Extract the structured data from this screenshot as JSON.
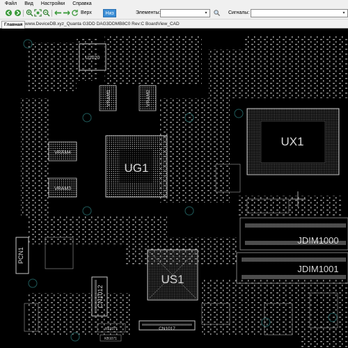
{
  "menu": {
    "file": "Файл",
    "view": "Вид",
    "settings": "Настройки",
    "help": "Справка"
  },
  "toolbar": {
    "side_top_label": "Верх",
    "side_bottom_label": "Низ",
    "elements_label": "Элементы:",
    "elements_value": "",
    "signals_label": "Сигналы:",
    "signals_value": "",
    "icons": [
      "back-arrow-icon",
      "forward-arrow-icon",
      "zoom-in-icon",
      "zoom-fit-icon",
      "zoom-out-icon",
      "flip-left-icon",
      "flip-right-icon",
      "rotate-icon",
      "search-icon",
      "search-icon"
    ]
  },
  "tabs": {
    "main": "Главная",
    "file": "www.DeviceDB.xyz_Quanta G3DD DAG3DDMB8C0 Rev:C BoardView_CAD"
  },
  "board": {
    "colors": {
      "background": "#000000",
      "outline": "#c8c8c8",
      "pads": "#bdbdbd",
      "label": "#d8d8d8",
      "mount": "#1f5a5a"
    },
    "components": [
      "UX1",
      "UG1",
      "US1",
      "JDIM1000",
      "JDIM1001",
      "VRAM1",
      "VRAM2",
      "VRAM3",
      "VRAM4",
      "PCN1",
      "CN1012",
      "CN1017",
      "U1020",
      "RE1071",
      "KB1071"
    ]
  }
}
